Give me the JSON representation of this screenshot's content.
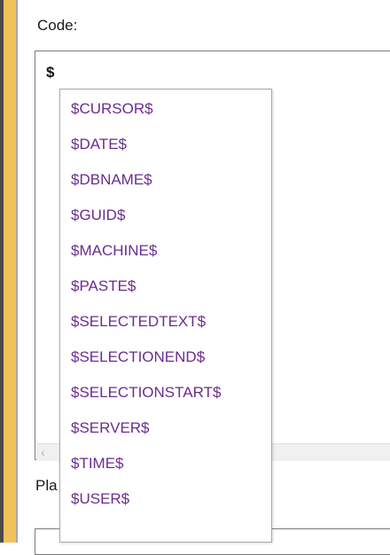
{
  "code_section": {
    "label": "Code:",
    "text": "$"
  },
  "placeholders_section": {
    "label": "Pla"
  },
  "completion": {
    "items": [
      "$CURSOR$",
      "$DATE$",
      "$DBNAME$",
      "$GUID$",
      "$MACHINE$",
      "$PASTE$",
      "$SELECTEDTEXT$",
      "$SELECTIONEND$",
      "$SELECTIONSTART$",
      "$SERVER$",
      "$TIME$",
      "$USER$"
    ],
    "text_color": "#6b2c8f"
  },
  "colors": {
    "accent_bar": "#f0c25a"
  },
  "icons": {
    "scroll_left": "chevron-left-icon"
  }
}
